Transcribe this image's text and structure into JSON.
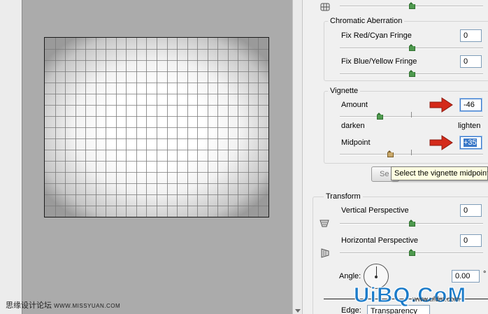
{
  "chromatic": {
    "title": "Chromatic Aberration",
    "red_cyan_label": "Fix Red/Cyan Fringe",
    "red_cyan_value": "0",
    "blue_yellow_label": "Fix Blue/Yellow Fringe",
    "blue_yellow_value": "0"
  },
  "vignette": {
    "title": "Vignette",
    "amount_label": "Amount",
    "amount_value": "-46",
    "darken_label": "darken",
    "lighten_label": "lighten",
    "midpoint_label": "Midpoint",
    "midpoint_value": "+35",
    "button_stub": "Se",
    "tooltip": "Select the vignette midpoint"
  },
  "transform": {
    "title": "Transform",
    "vertical_label": "Vertical Perspective",
    "vertical_value": "0",
    "horizontal_label": "Horizontal Perspective",
    "horizontal_value": "0",
    "angle_label": "Angle:",
    "angle_value": "0.00",
    "angle_unit": "°",
    "edge_label": "Edge:",
    "edge_value": "Transparency"
  },
  "watermarks": {
    "left_cn": "思缘设计论坛",
    "left_url": "WWW.MISSYUAN.COM",
    "right_logo": "UiBQ.CoM",
    "right_url": "www.ufdm.com"
  },
  "icons": {
    "arrow_color": "#d42a1a",
    "highlight_color": "#3a78c8"
  }
}
